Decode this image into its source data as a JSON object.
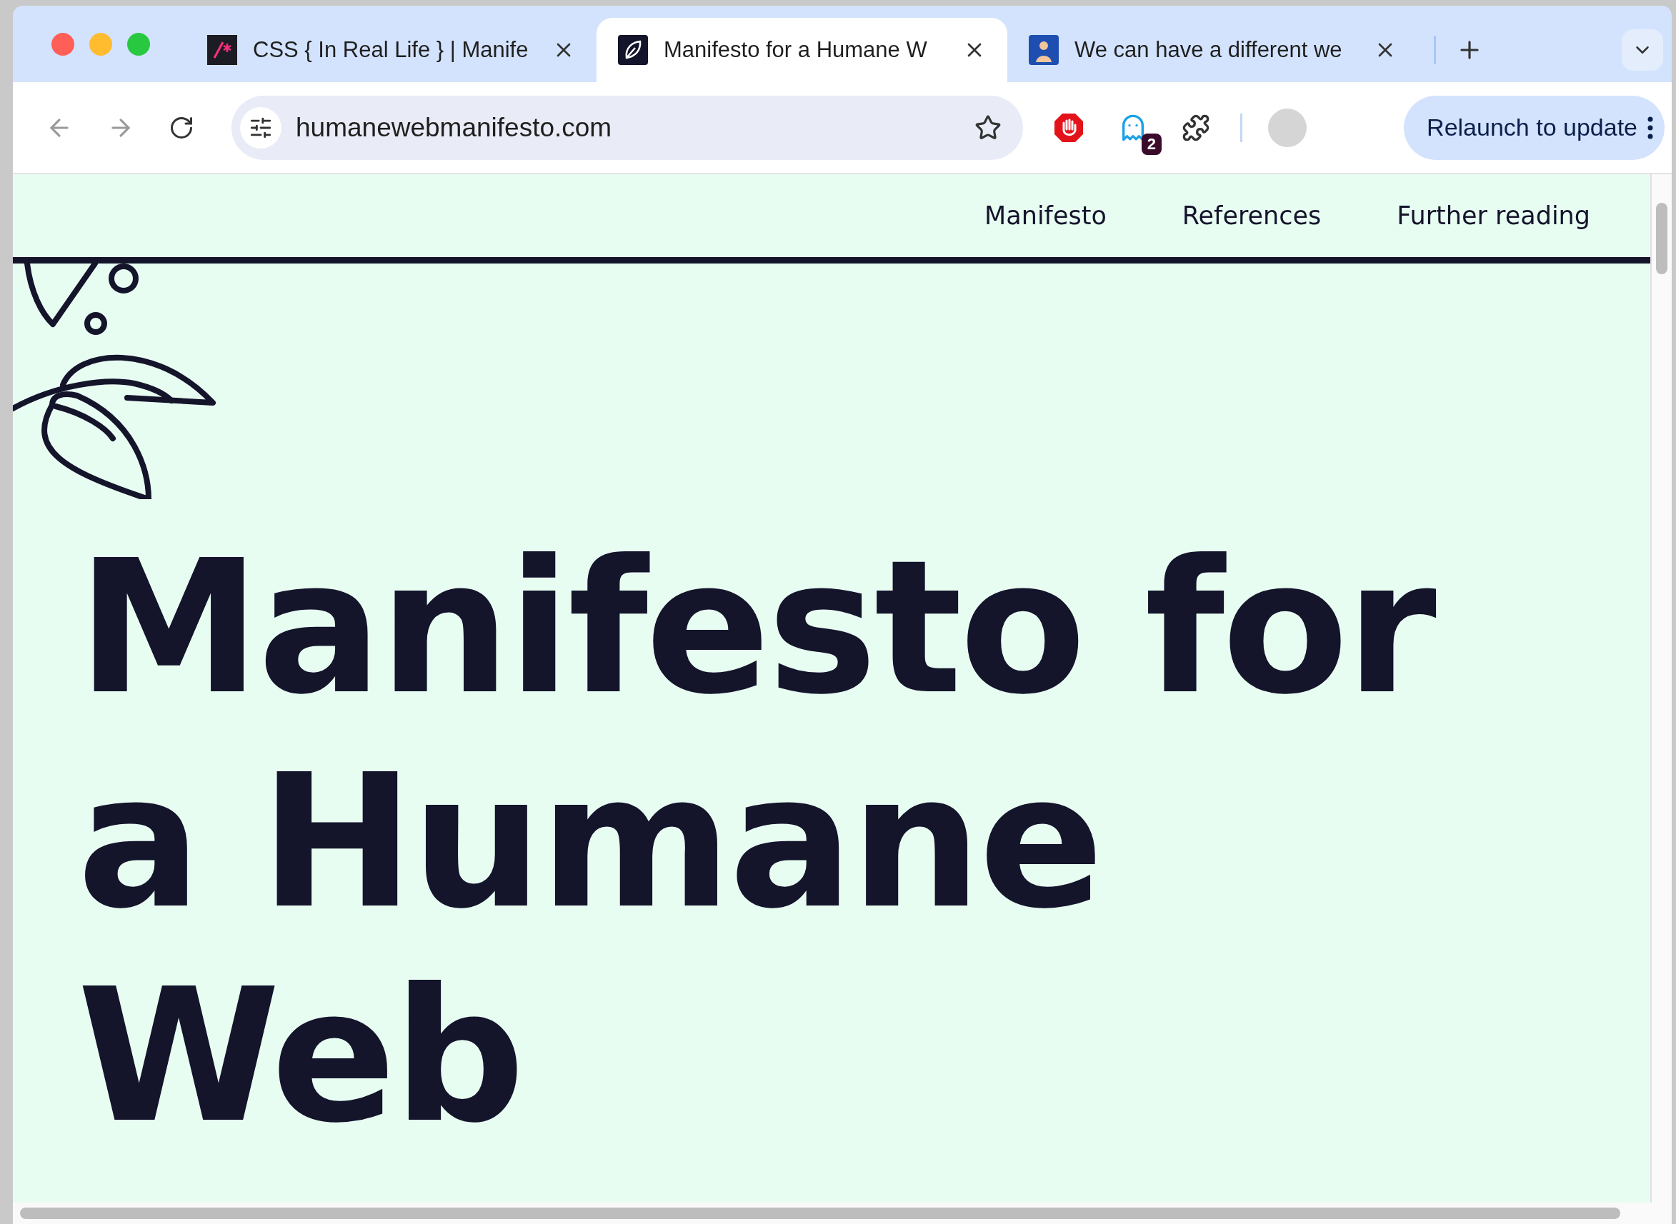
{
  "tabs": [
    {
      "title": "CSS { In Real Life } | Manife",
      "kind": "css",
      "selected": false
    },
    {
      "title": "Manifesto for a Humane W",
      "kind": "leaf",
      "selected": true
    },
    {
      "title": "We can have a different we",
      "kind": "photo",
      "selected": false
    }
  ],
  "address_bar": {
    "url": "humanewebmanifesto.com"
  },
  "extensions": [
    {
      "kind": "stop"
    },
    {
      "kind": "ghost",
      "badge": "2"
    },
    {
      "kind": "puzzle"
    }
  ],
  "relaunch_button": "Relaunch to update",
  "nav": [
    {
      "label": "Manifesto"
    },
    {
      "label": "References"
    },
    {
      "label": "Further reading"
    }
  ],
  "heading": "Manifesto for a Humane Web"
}
